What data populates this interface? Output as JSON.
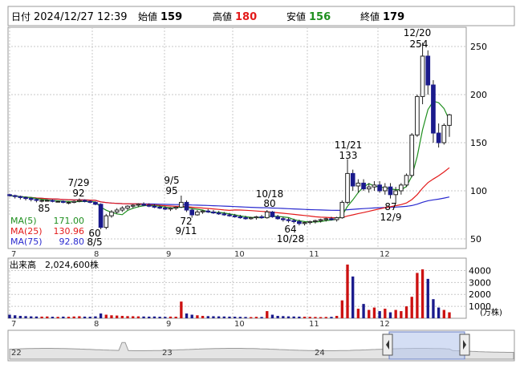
{
  "header": {
    "date_label": "日付",
    "datetime": "2024/12/27 12:39",
    "open_label": "始値",
    "open_value": "159",
    "high_label": "高値",
    "high_value": "180",
    "low_label": "安値",
    "low_value": "156",
    "close_label": "終値",
    "close_value": "179"
  },
  "legend": {
    "ma5_label": "MA(5)",
    "ma5_value": "171.00",
    "ma25_label": "MA(25)",
    "ma25_value": "130.96",
    "ma75_label": "MA(75)",
    "ma75_value": "92.80"
  },
  "volume_panel": {
    "label": "出来高",
    "value": "2,024,600株",
    "unit": "(万株)"
  },
  "colors": {
    "candle_up": "#ffffff",
    "candle_down": "#1a1a8c",
    "ma5": "#1f8f1f",
    "ma25": "#e31a1a",
    "ma75": "#2a2acf",
    "volume": "#cc1111",
    "volume_alt": "#1a1a8c",
    "grid": "#c8c8c8",
    "navigator_fill": "#b8c8ec"
  },
  "chart_data": [
    {
      "type": "line",
      "name": "price",
      "x_ticks": [
        "7",
        "8",
        "9",
        "10",
        "11",
        "12"
      ],
      "y_ticks": [
        50,
        100,
        150,
        200,
        250
      ],
      "ylim": [
        40,
        270
      ],
      "candles": [
        [
          96,
          97,
          94,
          95
        ],
        [
          95,
          96,
          92,
          94
        ],
        [
          94,
          95,
          91,
          93
        ],
        [
          93,
          94,
          90,
          92
        ],
        [
          92,
          93,
          89,
          91
        ],
        [
          91,
          92,
          88,
          90
        ],
        [
          90,
          91,
          88,
          90
        ],
        [
          90,
          91,
          89,
          90
        ],
        [
          90,
          91,
          88,
          89
        ],
        [
          89,
          90,
          88,
          89
        ],
        [
          89,
          90,
          87,
          88
        ],
        [
          88,
          89,
          86,
          88
        ],
        [
          88,
          90,
          87,
          89
        ],
        [
          89,
          92,
          88,
          90
        ],
        [
          90,
          91,
          88,
          89
        ],
        [
          89,
          90,
          87,
          88
        ],
        [
          88,
          89,
          85,
          86
        ],
        [
          86,
          87,
          60,
          62
        ],
        [
          62,
          76,
          60,
          74
        ],
        [
          74,
          80,
          72,
          78
        ],
        [
          78,
          82,
          76,
          80
        ],
        [
          80,
          84,
          78,
          82
        ],
        [
          82,
          85,
          80,
          84
        ],
        [
          84,
          86,
          82,
          85
        ],
        [
          85,
          87,
          83,
          86
        ],
        [
          86,
          88,
          84,
          85
        ],
        [
          85,
          87,
          83,
          84
        ],
        [
          84,
          86,
          82,
          83
        ],
        [
          83,
          85,
          81,
          82
        ],
        [
          82,
          84,
          80,
          81
        ],
        [
          81,
          83,
          79,
          82
        ],
        [
          82,
          84,
          80,
          83
        ],
        [
          83,
          95,
          82,
          88
        ],
        [
          88,
          90,
          78,
          80
        ],
        [
          80,
          82,
          72,
          75
        ],
        [
          75,
          80,
          74,
          78
        ],
        [
          78,
          80,
          76,
          79
        ],
        [
          79,
          81,
          77,
          78
        ],
        [
          78,
          80,
          76,
          77
        ],
        [
          77,
          79,
          75,
          76
        ],
        [
          76,
          78,
          74,
          75
        ],
        [
          75,
          77,
          73,
          74
        ],
        [
          74,
          76,
          72,
          73
        ],
        [
          73,
          75,
          71,
          72
        ],
        [
          72,
          74,
          70,
          71
        ],
        [
          71,
          73,
          70,
          72
        ],
        [
          72,
          74,
          70,
          73
        ],
        [
          73,
          75,
          71,
          72
        ],
        [
          72,
          80,
          71,
          78
        ],
        [
          78,
          79,
          72,
          73
        ],
        [
          73,
          75,
          70,
          71
        ],
        [
          71,
          73,
          68,
          70
        ],
        [
          70,
          72,
          67,
          69
        ],
        [
          69,
          71,
          66,
          68
        ],
        [
          68,
          70,
          64,
          66
        ],
        [
          66,
          68,
          64,
          67
        ],
        [
          67,
          69,
          65,
          68
        ],
        [
          68,
          70,
          66,
          69
        ],
        [
          69,
          71,
          67,
          70
        ],
        [
          70,
          72,
          68,
          71
        ],
        [
          71,
          73,
          69,
          70
        ],
        [
          70,
          73,
          68,
          72
        ],
        [
          72,
          90,
          71,
          88
        ],
        [
          88,
          133,
          86,
          118
        ],
        [
          118,
          122,
          100,
          105
        ],
        [
          105,
          112,
          98,
          108
        ],
        [
          108,
          112,
          100,
          102
        ],
        [
          102,
          108,
          98,
          104
        ],
        [
          104,
          110,
          100,
          106
        ],
        [
          106,
          110,
          98,
          100
        ],
        [
          100,
          108,
          96,
          104
        ],
        [
          104,
          108,
          92,
          96
        ],
        [
          96,
          104,
          87,
          100
        ],
        [
          100,
          108,
          96,
          106
        ],
        [
          106,
          118,
          104,
          116
        ],
        [
          116,
          160,
          114,
          158
        ],
        [
          158,
          200,
          156,
          198
        ],
        [
          198,
          254,
          190,
          240
        ],
        [
          240,
          246,
          200,
          210
        ],
        [
          210,
          215,
          150,
          160
        ],
        [
          160,
          170,
          145,
          150
        ],
        [
          150,
          170,
          148,
          168
        ],
        [
          168,
          180,
          156,
          179
        ]
      ],
      "high_label": {
        "date": "12/20",
        "value": 254
      },
      "labels": [
        {
          "text": "7/29",
          "value": "92"
        },
        {
          "text": "9/5",
          "value": "95"
        },
        {
          "text": "10/18",
          "value": "80"
        },
        {
          "text": "11/21",
          "value": "133"
        },
        {
          "text": "60",
          "value": "8/5"
        },
        {
          "text": "72",
          "value": "9/11"
        },
        {
          "text": "64",
          "value": "10/28"
        },
        {
          "text": "87",
          "value": "12/9"
        },
        {
          "text": "85",
          "value": ""
        }
      ],
      "ma5_last": 171.0,
      "ma25_last": 130.96,
      "ma75_last": 92.8
    },
    {
      "type": "bar",
      "name": "volume",
      "y_ticks": [
        1000,
        2000,
        3000,
        4000
      ],
      "ylim": [
        0,
        4500
      ],
      "values": [
        300,
        250,
        200,
        180,
        160,
        150,
        140,
        150,
        130,
        120,
        140,
        130,
        150,
        170,
        140,
        130,
        160,
        400,
        300,
        250,
        230,
        200,
        180,
        170,
        160,
        150,
        140,
        150,
        130,
        120,
        140,
        130,
        1400,
        400,
        300,
        250,
        200,
        180,
        170,
        160,
        150,
        140,
        130,
        120,
        110,
        100,
        120,
        110,
        600,
        300,
        200,
        180,
        160,
        150,
        140,
        130,
        120,
        110,
        100,
        110,
        120,
        200,
        1500,
        4500,
        3500,
        800,
        1200,
        700,
        900,
        600,
        800,
        500,
        700,
        600,
        1000,
        1800,
        3800,
        4100,
        3300,
        1600,
        900,
        700,
        500
      ]
    }
  ]
}
